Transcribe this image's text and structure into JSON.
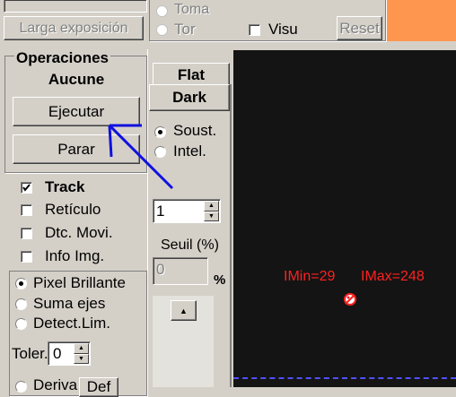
{
  "top": {
    "larga_label": "Larga exposición",
    "radio_toma": "Toma",
    "radio_tor": "Tor",
    "visu_label": "Visu",
    "reset_label": "Reset",
    "accent_color": "#ff9650"
  },
  "operaciones": {
    "title": "Operaciones",
    "status": "Aucune",
    "ejecutar_label": "Ejecutar",
    "parar_label": "Parar"
  },
  "tabs": {
    "flat": "Flat",
    "dark": "Dark"
  },
  "dark_opts": {
    "soust": "Soust.",
    "intel": "Intel."
  },
  "checks": {
    "track": "Track",
    "reticulo": "Retículo",
    "dtc_movi": "Dtc. Movi.",
    "info_img": "Info Img."
  },
  "count_value": "1",
  "seuil": {
    "label": "Seuil (%)",
    "value": "0",
    "unit": "%"
  },
  "detect": {
    "pixel_brillante": "Pixel Brillante",
    "suma_ejes": "Suma ejes",
    "detect_lim": "Detect.Lim."
  },
  "toler": {
    "label": "Toler.",
    "value": "0"
  },
  "deriva": {
    "label": "Deriva",
    "def_label": "Def"
  },
  "image_view": {
    "imin": "IMin=29",
    "imax": "IMax=248",
    "text_color": "#ff2020",
    "background": "#141414"
  }
}
